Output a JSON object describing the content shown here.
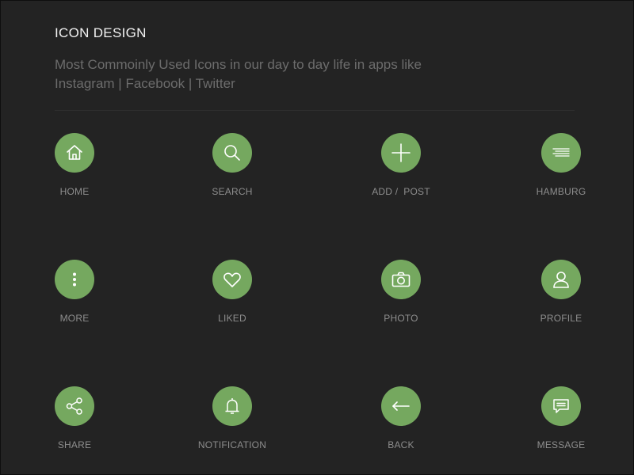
{
  "header": {
    "title": "ICON DESIGN",
    "subtitle_line1": "Most Commoinly Used Icons in our day to day life in apps like",
    "subtitle_line2": "Instagram | Facebook | Twitter"
  },
  "colors": {
    "background": "#222222",
    "accent": "#75a85f",
    "icon_stroke": "#ffffff",
    "label": "#8d8d8d",
    "title": "#f2f2f2",
    "subtitle": "#6c6c6c"
  },
  "icons": [
    {
      "label": "HOME",
      "icon": "home-icon"
    },
    {
      "label": "SEARCH",
      "icon": "search-icon"
    },
    {
      "label": "ADD /  POST",
      "icon": "plus-icon"
    },
    {
      "label": "HAMBURG",
      "icon": "hamburger-icon"
    },
    {
      "label": "MORE",
      "icon": "more-vertical-icon"
    },
    {
      "label": "LIKED",
      "icon": "heart-icon"
    },
    {
      "label": "PHOTO",
      "icon": "camera-icon"
    },
    {
      "label": "PROFILE",
      "icon": "user-icon"
    },
    {
      "label": "SHARE",
      "icon": "share-icon"
    },
    {
      "label": "NOTIFICATION",
      "icon": "bell-icon"
    },
    {
      "label": "BACK",
      "icon": "arrow-left-icon"
    },
    {
      "label": "MESSAGE",
      "icon": "message-icon"
    }
  ]
}
